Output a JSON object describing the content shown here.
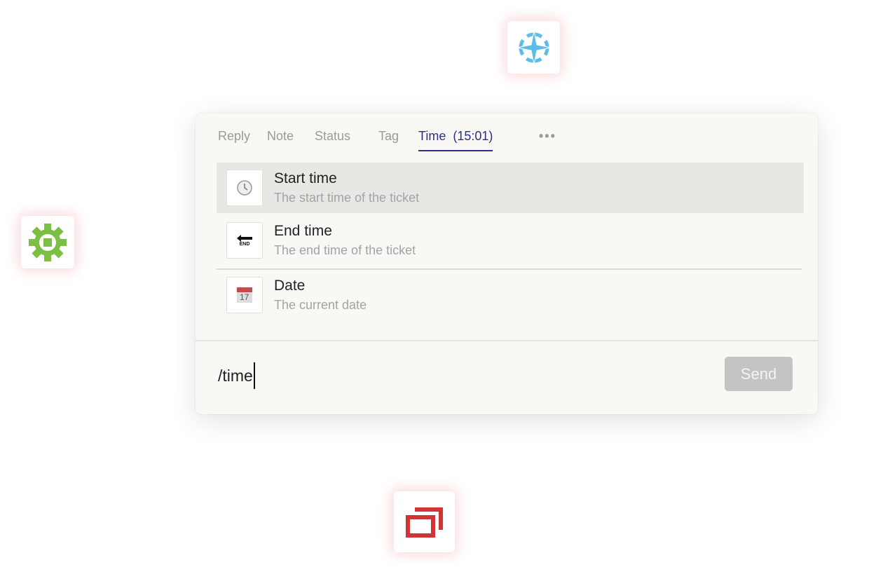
{
  "floating_icons": [
    {
      "name": "compass-star-icon",
      "color": "#5bbdea"
    },
    {
      "name": "gear-icon",
      "color": "#7dbf45"
    },
    {
      "name": "windows-stack-icon",
      "color": "#d03535"
    }
  ],
  "tabs": [
    {
      "label": "Reply",
      "active": false
    },
    {
      "label": "Note",
      "active": false
    },
    {
      "label": "Status",
      "active": false
    },
    {
      "label": "Tag",
      "active": false
    },
    {
      "label": "Time  (15:01)",
      "active": true
    }
  ],
  "more_label": "•••",
  "accent": "#2a2f86",
  "suggestions": [
    {
      "title": "Start time",
      "subtitle": "The start time of the ticket",
      "icon": "clock-icon",
      "selected": true
    },
    {
      "title": "End time",
      "subtitle": "The end time of the ticket",
      "icon": "end-arrow-icon",
      "selected": false
    },
    {
      "title": "Date",
      "subtitle": "The current date",
      "icon": "calendar-icon",
      "selected": false
    }
  ],
  "end_icon_text": "END",
  "calendar_day": "17",
  "composer": {
    "value": "/time",
    "send_label": "Send"
  }
}
